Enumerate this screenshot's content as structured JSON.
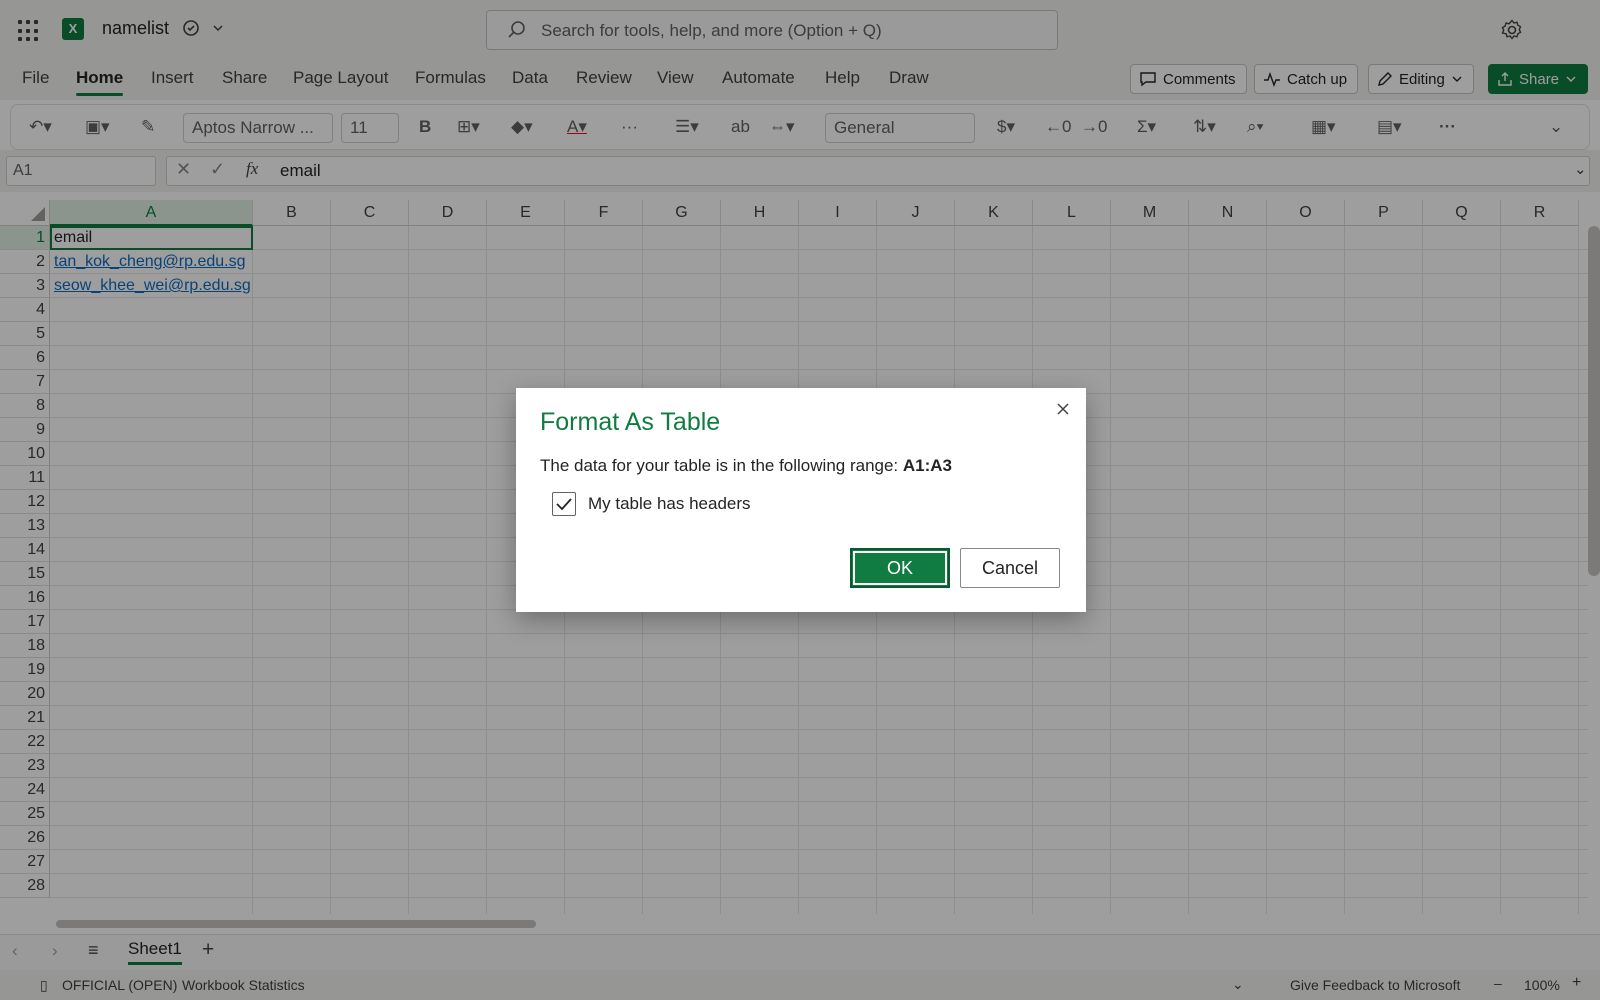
{
  "app": {
    "doc_name": "namelist",
    "logo_letter": "X",
    "search_placeholder": "Search for tools, help, and more (Option + Q)",
    "accent": "#107c41"
  },
  "menu": {
    "tabs": [
      "File",
      "Home",
      "Insert",
      "Share",
      "Page Layout",
      "Formulas",
      "Data",
      "Review",
      "View",
      "Automate",
      "Help",
      "Draw"
    ],
    "active": "Home",
    "comments_label": "Comments",
    "catchup_label": "Catch up",
    "editing_label": "Editing",
    "share_label": "Share"
  },
  "ribbon": {
    "font_name": "Aptos Narrow ...",
    "font_size": "11",
    "number_format": "General"
  },
  "formula_bar": {
    "name_box": "A1",
    "fx": "fx",
    "value": "email"
  },
  "sheet": {
    "columns": [
      "A",
      "B",
      "C",
      "D",
      "E",
      "F",
      "G",
      "H",
      "I",
      "J",
      "K",
      "L",
      "M",
      "N",
      "O",
      "P",
      "Q",
      "R"
    ],
    "rows": [
      "1",
      "2",
      "3",
      "4",
      "5",
      "6",
      "7",
      "8",
      "9",
      "10",
      "11",
      "12",
      "13",
      "14",
      "15",
      "16",
      "17",
      "18",
      "19",
      "20",
      "21",
      "22",
      "23",
      "24",
      "25",
      "26",
      "27",
      "28"
    ],
    "cells": {
      "A1": "email",
      "A2": "tan_kok_cheng@rp.edu.sg",
      "A3": "seow_khee_wei@rp.edu.sg"
    },
    "tab_name": "Sheet1"
  },
  "status": {
    "label": "OFFICIAL (OPEN)",
    "stats": "Workbook Statistics",
    "feedback": "Give Feedback to Microsoft",
    "zoom": "100%"
  },
  "dialog": {
    "title": "Format As Table",
    "text": "The data for your table is in the following range:",
    "range": "A1:A3",
    "checkbox_label": "My table has headers",
    "checkbox_checked": true,
    "ok_label": "OK",
    "cancel_label": "Cancel"
  }
}
